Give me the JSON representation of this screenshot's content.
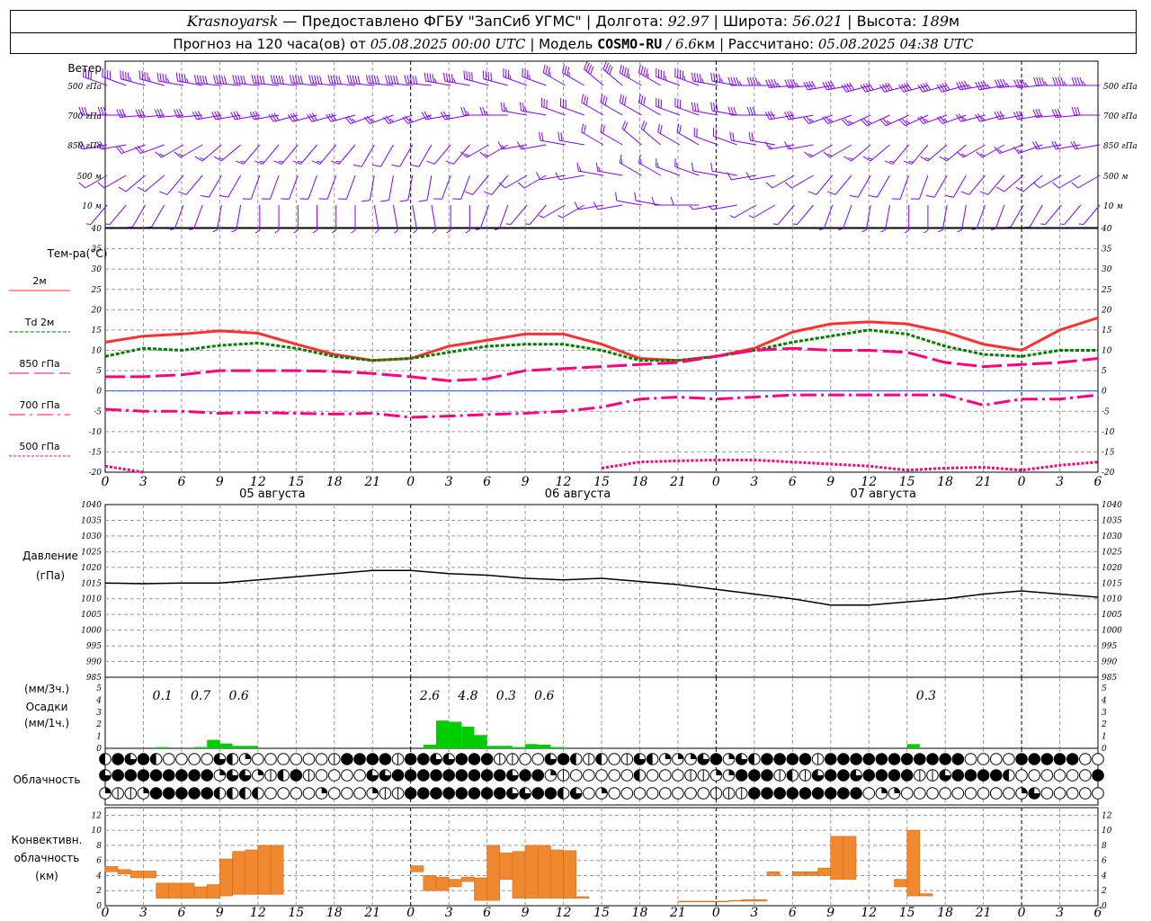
{
  "header": {
    "city": "Krasnoyarsk",
    "provider": "— Предоставлено ФГБУ \"ЗапСиб УГМС\"",
    "lon_label": "| Долгота:",
    "lon": "92.97",
    "lat_label": "| Широта:",
    "lat": "56.021",
    "alt_label": "| Высота:",
    "alt": "189",
    "alt_unit": "м",
    "forecast_label": "Прогноз на 120 часа(ов) от",
    "forecast_time": "05.08.2025 00:00 UTC",
    "model_label": "| Модель",
    "model": "COSMO-RU",
    "model_sep": "/",
    "resolution": "6.6",
    "res_unit": "км",
    "calc_label": "| Рассчитано:",
    "calc_time": "05.08.2025 04:38 UTC"
  },
  "wind_panel": {
    "title": "Ветер",
    "levels": [
      {
        "label": "500 гПа",
        "dir": [
          290,
          285,
          280,
          275,
          275,
          275,
          275,
          275,
          275,
          280,
          285,
          290,
          300,
          310,
          300,
          290,
          280,
          270,
          265,
          260,
          255,
          255,
          255,
          260,
          265,
          270,
          270
        ],
        "speed": [
          20,
          22,
          22,
          25,
          25,
          25,
          25,
          25,
          25,
          22,
          20,
          18,
          18,
          20,
          22,
          22,
          22,
          22,
          22,
          20,
          20,
          20,
          20,
          22,
          22,
          22,
          22
        ]
      },
      {
        "label": "700 гПа",
        "dir": [
          270,
          265,
          265,
          260,
          260,
          255,
          255,
          250,
          250,
          260,
          270,
          280,
          290,
          300,
          300,
          290,
          280,
          270,
          260,
          250,
          245,
          245,
          250,
          255,
          260,
          265,
          270
        ],
        "speed": [
          15,
          15,
          16,
          16,
          15,
          15,
          14,
          13,
          12,
          12,
          12,
          13,
          14,
          15,
          16,
          16,
          15,
          14,
          14,
          13,
          13,
          13,
          13,
          13,
          14,
          14,
          14
        ]
      },
      {
        "label": "850 гПа",
        "dir": [
          260,
          250,
          240,
          230,
          220,
          220,
          220,
          210,
          210,
          220,
          240,
          260,
          280,
          300,
          310,
          300,
          290,
          280,
          260,
          240,
          230,
          220,
          230,
          240,
          250,
          260,
          260
        ],
        "speed": [
          10,
          9,
          8,
          8,
          8,
          7,
          7,
          6,
          6,
          6,
          7,
          8,
          9,
          10,
          10,
          10,
          9,
          9,
          8,
          8,
          8,
          8,
          8,
          8,
          8,
          9,
          9
        ]
      },
      {
        "label": "500 м",
        "dir": [
          240,
          230,
          220,
          210,
          200,
          200,
          200,
          190,
          190,
          200,
          220,
          240,
          260,
          280,
          300,
          290,
          280,
          260,
          240,
          220,
          210,
          200,
          210,
          220,
          230,
          240,
          240
        ],
        "speed": [
          4,
          5,
          5,
          6,
          6,
          5,
          5,
          4,
          4,
          4,
          4,
          5,
          6,
          7,
          7,
          7,
          6,
          6,
          6,
          5,
          5,
          5,
          5,
          5,
          5,
          6,
          6
        ]
      },
      {
        "label": "10 м",
        "dir": [
          220,
          210,
          200,
          190,
          180,
          180,
          180,
          170,
          170,
          180,
          200,
          220,
          240,
          260,
          280,
          270,
          260,
          240,
          220,
          200,
          190,
          180,
          190,
          200,
          210,
          220,
          220
        ],
        "speed": [
          2,
          3,
          3,
          3,
          3,
          2,
          2,
          2,
          2,
          2,
          2,
          3,
          3,
          4,
          4,
          4,
          3,
          3,
          3,
          3,
          3,
          2,
          3,
          3,
          3,
          3,
          3
        ]
      }
    ],
    "barb_color": "#8000ff"
  },
  "chart_data": [
    {
      "type": "line",
      "ylabel": "Тем-ра(°С)",
      "ylim": [
        -20,
        40
      ],
      "yticks": [
        -20,
        -15,
        -10,
        -5,
        0,
        5,
        10,
        15,
        20,
        25,
        30,
        35,
        40
      ],
      "x_hours_every3": [
        0,
        3,
        6,
        9,
        12,
        15,
        18,
        21,
        24,
        27,
        30,
        33,
        36,
        39,
        42,
        45,
        48,
        51,
        54,
        57,
        60,
        63,
        66,
        69,
        72,
        75,
        78
      ],
      "xtick_labels": [
        "0",
        "3",
        "6",
        "9",
        "12",
        "15",
        "18",
        "21",
        "0",
        "3",
        "6",
        "9",
        "12",
        "15",
        "18",
        "21",
        "0",
        "3",
        "6",
        "9",
        "12",
        "15",
        "18",
        "21",
        "0",
        "3",
        "6"
      ],
      "date_labels": [
        "05 августа",
        "06 августа",
        "07 августа"
      ],
      "grid": true,
      "series": [
        {
          "name": "2м",
          "color": "#ff3030",
          "dash": "",
          "values": [
            12,
            13.5,
            14,
            14.8,
            14.2,
            11.5,
            9,
            7.5,
            8,
            11,
            12.5,
            14,
            14,
            11.5,
            8,
            7.5,
            8.5,
            10.5,
            14.5,
            16.5,
            17,
            16.5,
            14.5,
            11.5,
            10,
            15,
            18
          ]
        },
        {
          "name": "Td 2м",
          "color": "#008000",
          "dash": "4,2",
          "values": [
            8.5,
            10.5,
            10,
            11.2,
            11.8,
            10.5,
            8.5,
            7.5,
            8,
            9.5,
            11,
            11.5,
            11.5,
            10,
            7.5,
            7.5,
            8.5,
            10,
            12,
            13.5,
            15,
            14,
            11,
            9,
            8.5,
            10,
            10
          ]
        },
        {
          "name": "850 гПа",
          "color": "#ff0080",
          "dash": "22,6",
          "values": [
            3.5,
            3.5,
            4,
            5,
            5,
            5,
            4.8,
            4.3,
            3.5,
            2.5,
            3,
            5,
            5.5,
            6,
            6.5,
            7,
            8.5,
            10,
            10.5,
            10,
            10,
            9.5,
            7,
            6,
            6.5,
            7,
            8
          ]
        },
        {
          "name": "700 гПа",
          "color": "#ff0080",
          "dash": "18,5,3,5",
          "values": [
            -4.5,
            -5,
            -5,
            -5.5,
            -5.3,
            -5.5,
            -5.7,
            -5.5,
            -6.5,
            -6.2,
            -5.8,
            -5.5,
            -5,
            -4,
            -2,
            -1.5,
            -2,
            -1.5,
            -1,
            -1,
            -1,
            -1,
            -1,
            -3.5,
            -2,
            -2,
            -1
          ]
        },
        {
          "name": "500 гПа",
          "color": "#ff0080",
          "dash": "3,2",
          "values": [
            -18.5,
            -20,
            null,
            null,
            null,
            null,
            null,
            null,
            null,
            null,
            null,
            null,
            null,
            -19,
            -17.5,
            -17.2,
            -17,
            -17,
            -17.5,
            -18,
            -18.5,
            -19.5,
            -19,
            -18.8,
            -19.5,
            -18.3,
            -17.5
          ]
        }
      ]
    },
    {
      "type": "line",
      "ylabel": "Давление",
      "ylabel2": "(гПа)",
      "ylim": [
        985,
        1040
      ],
      "yticks": [
        985,
        990,
        995,
        1000,
        1005,
        1010,
        1015,
        1020,
        1025,
        1030,
        1035,
        1040
      ],
      "x_hours_every3": [
        0,
        3,
        6,
        9,
        12,
        15,
        18,
        21,
        24,
        27,
        30,
        33,
        36,
        39,
        42,
        45,
        48,
        51,
        54,
        57,
        60,
        63,
        66,
        69,
        72,
        75,
        78
      ],
      "series": [
        {
          "color": "#000000",
          "values": [
            1015,
            1014.8,
            1015,
            1015,
            1016,
            1017,
            1018,
            1019,
            1019,
            1018,
            1017.5,
            1016.5,
            1016,
            1016.5,
            1015.5,
            1014.5,
            1013,
            1011.5,
            1010,
            1008,
            1008,
            1009,
            1010,
            1011.5,
            1012.5,
            1011.5,
            1010.5
          ]
        }
      ]
    },
    {
      "type": "bar",
      "ylabel_top": "(мм/3ч.)",
      "ylabel": "Осадки",
      "ylabel2": "(мм/1ч.)",
      "ylim": [
        0,
        5
      ],
      "yticks": [
        0,
        1,
        2,
        3,
        4,
        5
      ],
      "color": "#00cc00",
      "hourly": {
        "4": 0.1,
        "7": 0.1,
        "8": 0.7,
        "9": 0.4,
        "10": 0.2,
        "11": 0.2,
        "25": 0.3,
        "26": 2.3,
        "27": 2.2,
        "28": 1.8,
        "29": 1.1,
        "30": 0.2,
        "31": 0.2,
        "32": 0.1,
        "33": 0.35,
        "34": 0.3,
        "35": 0.1,
        "63": 0.35
      },
      "sum3h_labels": [
        {
          "hour": 4.5,
          "text": "0.1"
        },
        {
          "hour": 7.5,
          "text": "0.7"
        },
        {
          "hour": 10.5,
          "text": "0.6"
        },
        {
          "hour": 25.5,
          "text": "2.6"
        },
        {
          "hour": 28.5,
          "text": "4.8"
        },
        {
          "hour": 31.5,
          "text": "0.3"
        },
        {
          "hour": 34.5,
          "text": "0.6"
        },
        {
          "hour": 64.5,
          "text": "0.3"
        }
      ]
    },
    {
      "type": "table",
      "label": "Облачность",
      "legend": "e=clear l=1/8 q=1/4 h=1/2 t=3/4 f=overcast",
      "rows": [
        "hftfheeeethqeeeeeelfffflffttffflleetfhlhelthqqqtfqthfffflfffffffffffeeeefffff",
        "tffffffffqttqlhfleeeettffffffffftffqleeeeeheeellqqffflhltfftfffflltffffheeeeeeffff",
        "qllqfffffhhhheeeeqeeeqllffffffffttffhteqeeeeeeeelllfffffffffeqqeeeeeeeeeqteeeeeee"
      ]
    },
    {
      "type": "bar",
      "ylabel": "Конвективн.",
      "ylabel2": "облачность",
      "ylabel3": "(км)",
      "ylim": [
        0,
        13
      ],
      "yticks": [
        0,
        2,
        4,
        6,
        8,
        10,
        12
      ],
      "color": "#f08830",
      "bars": [
        {
          "h": 0,
          "base": 4.5,
          "top": 5.2
        },
        {
          "h": 1,
          "base": 4.2,
          "top": 4.8
        },
        {
          "h": 2,
          "base": 3.7,
          "top": 4.6
        },
        {
          "h": 3,
          "base": 3.7,
          "top": 4.6
        },
        {
          "h": 4,
          "base": 1,
          "top": 3
        },
        {
          "h": 5,
          "base": 1,
          "top": 3
        },
        {
          "h": 6,
          "base": 1,
          "top": 3
        },
        {
          "h": 7,
          "base": 1,
          "top": 2.5
        },
        {
          "h": 8,
          "base": 1,
          "top": 2.8
        },
        {
          "h": 9,
          "base": 1.3,
          "top": 6.2
        },
        {
          "h": 10,
          "base": 1.5,
          "top": 7.2
        },
        {
          "h": 11,
          "base": 1.5,
          "top": 7.4
        },
        {
          "h": 12,
          "base": 1.5,
          "top": 8
        },
        {
          "h": 13,
          "base": 1.5,
          "top": 8
        },
        {
          "h": 24,
          "base": 4.5,
          "top": 5.3
        },
        {
          "h": 25,
          "base": 2,
          "top": 4
        },
        {
          "h": 26,
          "base": 2,
          "top": 3.8
        },
        {
          "h": 27,
          "base": 2.5,
          "top": 3.5
        },
        {
          "h": 28,
          "base": 3.2,
          "top": 3.8
        },
        {
          "h": 29,
          "base": 0.7,
          "top": 3.7
        },
        {
          "h": 30,
          "base": 0.7,
          "top": 8
        },
        {
          "h": 31,
          "base": 3.5,
          "top": 7
        },
        {
          "h": 32,
          "base": 1,
          "top": 7.2
        },
        {
          "h": 33,
          "base": 1,
          "top": 8
        },
        {
          "h": 34,
          "base": 1,
          "top": 8
        },
        {
          "h": 35,
          "base": 1,
          "top": 7.4
        },
        {
          "h": 36,
          "base": 1,
          "top": 7.3
        },
        {
          "h": 37,
          "base": 1,
          "top": 1.2
        },
        {
          "h": 45,
          "base": 0.5,
          "top": 0.6
        },
        {
          "h": 46,
          "base": 0.5,
          "top": 0.6
        },
        {
          "h": 47,
          "base": 0.5,
          "top": 0.6
        },
        {
          "h": 48,
          "base": 0.5,
          "top": 0.6
        },
        {
          "h": 49,
          "base": 0.6,
          "top": 0.7
        },
        {
          "h": 50,
          "base": 0.6,
          "top": 0.8
        },
        {
          "h": 51,
          "base": 0.6,
          "top": 0.8
        },
        {
          "h": 52,
          "base": 4,
          "top": 4.5
        },
        {
          "h": 54,
          "base": 4,
          "top": 4.5
        },
        {
          "h": 55,
          "base": 4,
          "top": 4.5
        },
        {
          "h": 56,
          "base": 4,
          "top": 5
        },
        {
          "h": 57,
          "base": 3.5,
          "top": 9.2
        },
        {
          "h": 58,
          "base": 3.5,
          "top": 9.2
        },
        {
          "h": 62,
          "base": 2.5,
          "top": 3.5
        },
        {
          "h": 63,
          "base": 1.3,
          "top": 10
        },
        {
          "h": 64,
          "base": 1.3,
          "top": 1.6
        }
      ]
    }
  ]
}
